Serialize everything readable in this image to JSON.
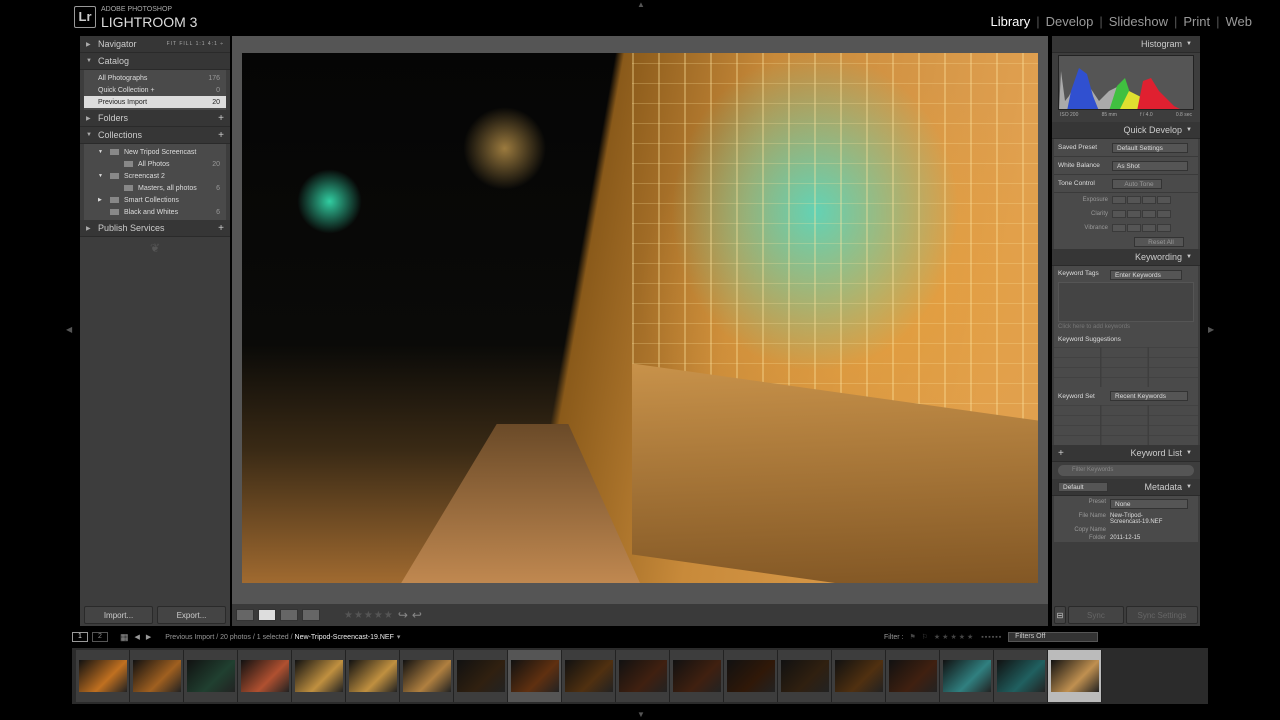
{
  "app": {
    "logo": "Lr",
    "vendor": "ADOBE PHOTOSHOP",
    "name": "LIGHTROOM 3"
  },
  "modules": [
    "Library",
    "Develop",
    "Slideshow",
    "Print",
    "Web"
  ],
  "active_module": "Library",
  "left": {
    "navigator": {
      "title": "Navigator",
      "zoom": "FIT  FILL  1:1  4:1 ÷"
    },
    "catalog": {
      "title": "Catalog",
      "items": [
        {
          "label": "All Photographs",
          "count": "176"
        },
        {
          "label": "Quick Collection +",
          "count": "0"
        },
        {
          "label": "Previous Import",
          "count": "20",
          "selected": true
        }
      ]
    },
    "folders": {
      "title": "Folders"
    },
    "collections": {
      "title": "Collections",
      "items": [
        {
          "label": "New Tripod Screencast",
          "count": "",
          "indent": 0,
          "expand": "▼"
        },
        {
          "label": "All Photos",
          "count": "20",
          "indent": 1,
          "expand": ""
        },
        {
          "label": "Screencast 2",
          "count": "",
          "indent": 0,
          "expand": "▼"
        },
        {
          "label": "Masters, all photos",
          "count": "6",
          "indent": 1,
          "expand": ""
        },
        {
          "label": "Smart Collections",
          "count": "",
          "indent": 0,
          "expand": "▶"
        },
        {
          "label": "Black and Whites",
          "count": "6",
          "indent": 0,
          "expand": ""
        }
      ]
    },
    "publish": {
      "title": "Publish Services"
    },
    "import": "Import...",
    "export": "Export..."
  },
  "toolbar": {
    "rating": "★★★★★",
    "rotate_left": "↪",
    "rotate_right": "↩"
  },
  "right": {
    "histogram": {
      "title": "Histogram",
      "iso": "ISO 200",
      "focal": "85 mm",
      "aperture": "f / 4.0",
      "shutter": "0.8 sec"
    },
    "quick_develop": {
      "title": "Quick Develop",
      "saved_preset_label": "Saved Preset",
      "saved_preset": "Default Settings",
      "wb_label": "White Balance",
      "wb": "As Shot",
      "tone_label": "Tone Control",
      "auto_tone": "Auto Tone",
      "exposure": "Exposure",
      "clarity": "Clarity",
      "vibrance": "Vibrance",
      "reset": "Reset All"
    },
    "keywording": {
      "title": "Keywording",
      "tags_label": "Keyword Tags",
      "tags_value": "Enter Keywords",
      "hint": "Click here to add keywords",
      "suggestions": "Keyword Suggestions",
      "set_label": "Keyword Set",
      "set_value": "Recent Keywords"
    },
    "keyword_list": {
      "title": "Keyword List",
      "filter_placeholder": "Filter Keywords"
    },
    "metadata": {
      "title": "Metadata",
      "preset_select": "Default",
      "preset_label": "Preset",
      "preset": "None",
      "file_name_label": "File Name",
      "file_name": "New-Tripod-Screencast-19.NEF",
      "copy_name_label": "Copy Name",
      "folder_label": "Folder",
      "folder": "2011-12-15"
    },
    "sync": "Sync",
    "sync_settings": "Sync Settings"
  },
  "filmstrip": {
    "monitor1": "1",
    "monitor2": "2",
    "path": "Previous Import / 20 photos / 1 selected / ",
    "file": "New-Tripod-Screencast-19.NEF",
    "filter_label": "Filter :",
    "filter_value": "Filters Off"
  },
  "thumbnails": [
    "#c07020",
    "#a06020",
    "#204030",
    "#b05030",
    "#c09040",
    "#c09040",
    "#b08040",
    "#302010",
    "#603010",
    "#503010",
    "#402010",
    "#402010",
    "#301808",
    "#302010",
    "#503010",
    "#402010",
    "#308080",
    "#206060",
    "#c09050"
  ],
  "selected_thumbnail": 18
}
